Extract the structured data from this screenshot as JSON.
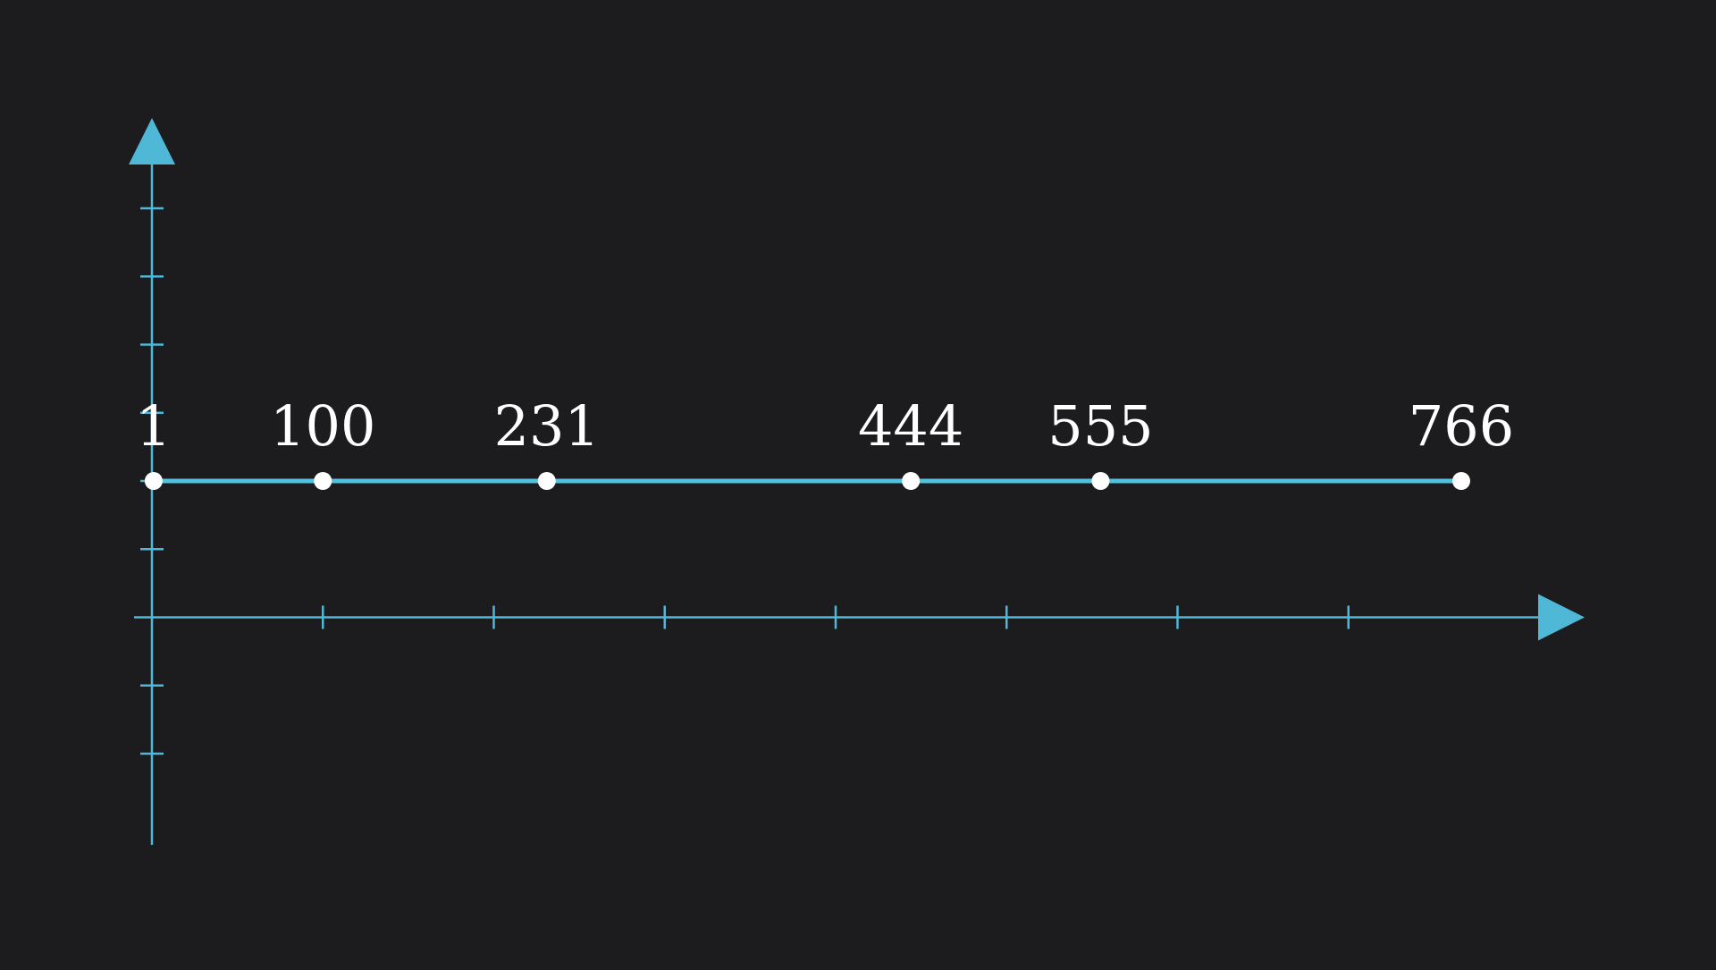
{
  "chart_data": {
    "type": "line",
    "title": "",
    "xlabel": "",
    "ylabel": "",
    "x": [
      1,
      100,
      231,
      444,
      555,
      766
    ],
    "y": [
      1,
      1,
      1,
      1,
      1,
      1
    ],
    "point_labels": [
      "1",
      "100",
      "231",
      "444",
      "555",
      "766"
    ],
    "xlim": [
      0,
      800
    ],
    "ylim": [
      -1,
      3
    ],
    "x_tick_step": 100,
    "y_tick_step": 0.5,
    "grid": false,
    "legend": "none"
  },
  "colors": {
    "background": "#1c1c1e",
    "axis": "#4fb8d6",
    "line": "#4fc3df",
    "point": "#ffffff",
    "label": "#ffffff"
  }
}
